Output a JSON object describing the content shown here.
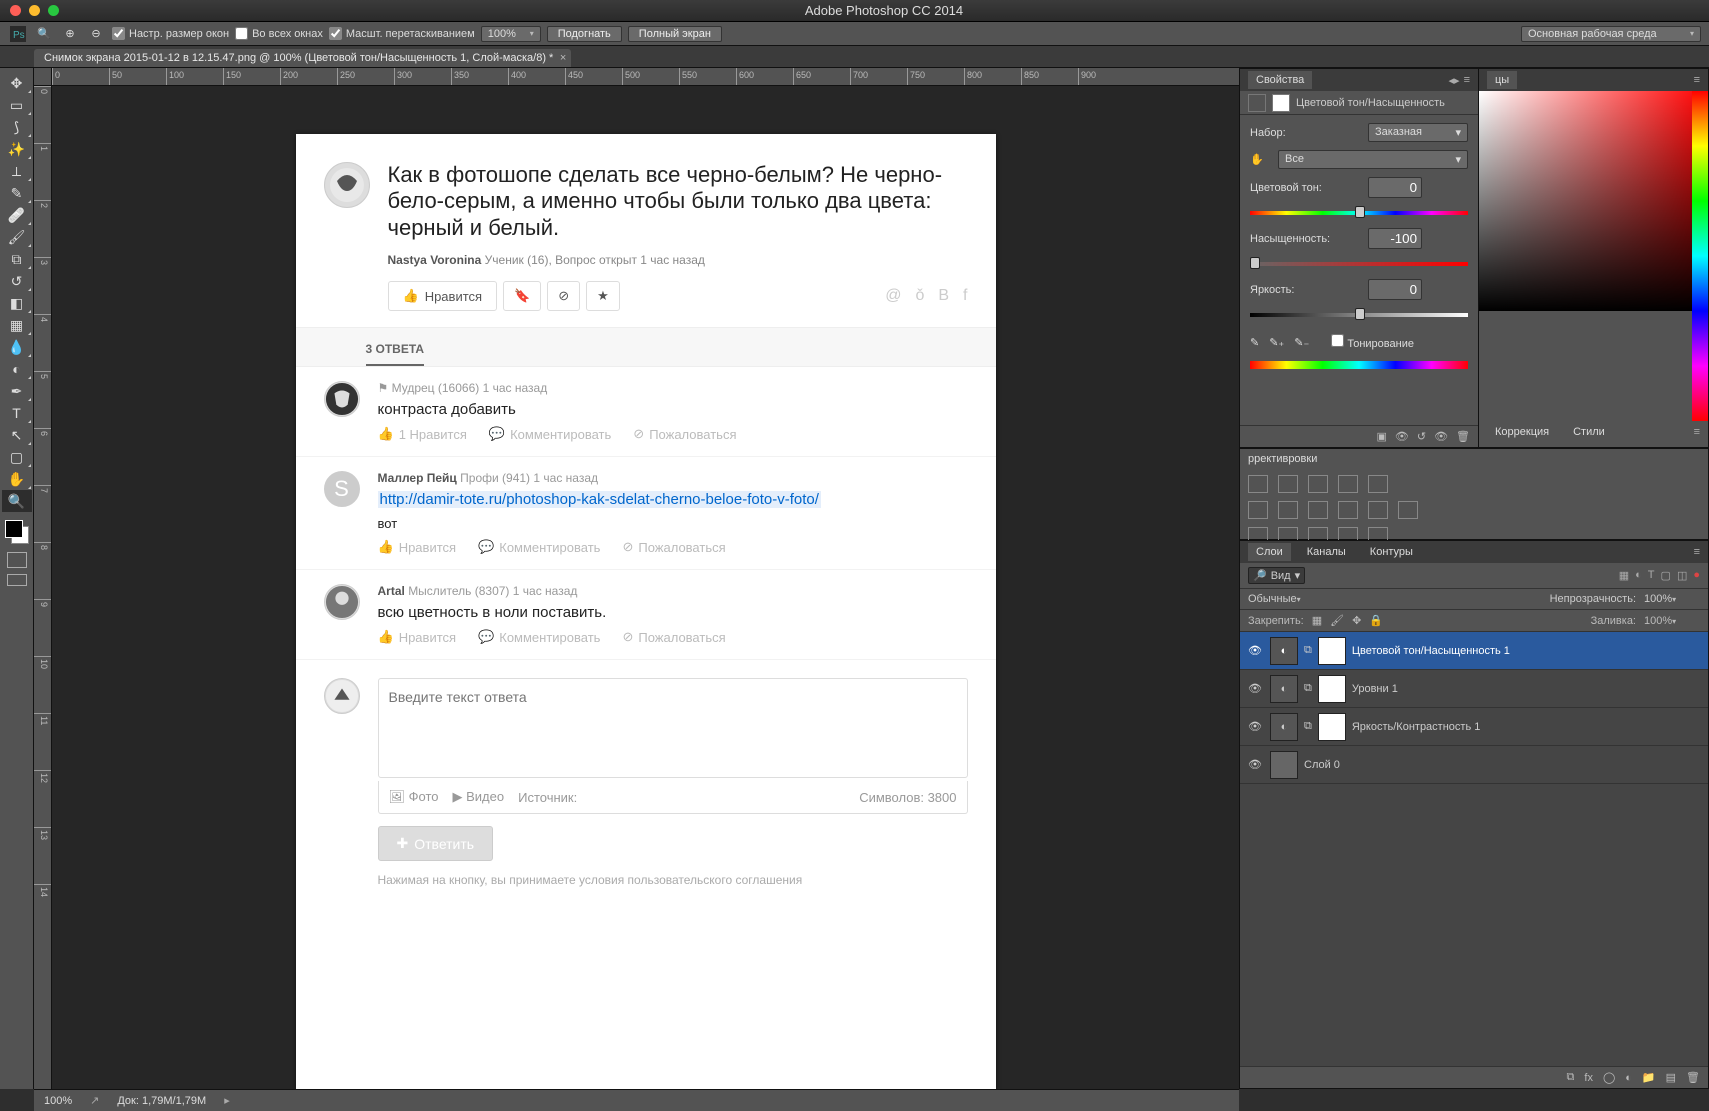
{
  "app_title": "Adobe Photoshop CC 2014",
  "workspace": "Основная рабочая среда",
  "options": {
    "resize_windows": "Настр. размер окон",
    "all_windows": "Во всех окнах",
    "scrubby": "Масшт. перетаскиванием",
    "zoom_pct": "100%",
    "fit": "Подогнать",
    "fullscreen": "Полный экран"
  },
  "doc_tab": "Снимок экрана 2015-01-12 в 12.15.47.png @ 100% (Цветовой тон/Насыщенность 1, Слой-маска/8) *",
  "ruler_marks_h": [
    "0",
    "50",
    "100",
    "150",
    "200",
    "250",
    "300",
    "350",
    "400",
    "450",
    "500",
    "550",
    "600",
    "650",
    "700",
    "750",
    "800",
    "850",
    "900"
  ],
  "ruler_marks_v": [
    "0",
    "1",
    "2",
    "3",
    "4",
    "5",
    "6",
    "7",
    "8",
    "9",
    "10",
    "11",
    "12",
    "13",
    "14"
  ],
  "question": {
    "title": "Как в фотошопе сделать все черно-белым? Не черно-бело-серым, а именно чтобы были только два цвета: черный и белый.",
    "author": "Nastya Voronina",
    "author_rank": "Ученик (16), Вопрос открыт 1 час назад",
    "like": "Нравится",
    "answers_header": "3 ОТВЕТА"
  },
  "answers": [
    {
      "author": "",
      "rank": "Мудрец (16066)",
      "time": "1 час назад",
      "text": "контраста добавить",
      "like": "1 Нравится",
      "comment": "Комментировать",
      "complain": "Пожаловаться"
    },
    {
      "author": "Маллер Пейц",
      "rank": "Профи (941)",
      "time": "1 час назад",
      "link": "http://damir-tote.ru/photoshop-kak-sdelat-cherno-beloe-foto-v-foto/",
      "text2": "вот",
      "like": "Нравится",
      "comment": "Комментировать",
      "complain": "Пожаловаться"
    },
    {
      "author": "Artal",
      "rank": "Мыслитель (8307)",
      "time": "1 час назад",
      "text": "всю цветность в ноли поставить.",
      "like": "Нравится",
      "comment": "Комментировать",
      "complain": "Пожаловаться"
    }
  ],
  "reply": {
    "placeholder": "Введите текст ответа",
    "photo": "Фото",
    "video": "Видео",
    "source": "Источник:",
    "chars": "Символов: 3800",
    "submit": "Ответить",
    "tos": "Нажимая на кнопку, вы принимаете условия пользовательского соглашения"
  },
  "props": {
    "panel_name": "Свойства",
    "title": "Цветовой тон/Насыщенность",
    "preset_lbl": "Набор:",
    "preset_val": "Заказная",
    "channel_val": "Все",
    "hue_lbl": "Цветовой тон:",
    "hue_val": "0",
    "sat_lbl": "Насыщенность:",
    "sat_val": "-100",
    "lig_lbl": "Яркость:",
    "lig_val": "0",
    "colorize": "Тонирование"
  },
  "swatches_tab": "цы",
  "corrections_tab": "Коррекция",
  "styles_tab": "Стили",
  "adjustments_lbl": "ррективровки",
  "layers": {
    "tab_layers": "Слои",
    "tab_channels": "Каналы",
    "tab_paths": "Контуры",
    "filter": "Вид",
    "blend_mode": "Обычные",
    "opacity_lbl": "Непрозрачность:",
    "opacity_val": "100%",
    "lock_lbl": "Закрепить:",
    "fill_lbl": "Заливка:",
    "fill_val": "100%",
    "rows": [
      {
        "name": "Цветовой тон/Насыщенность 1",
        "sel": true
      },
      {
        "name": "Уровни 1",
        "sel": false
      },
      {
        "name": "Яркость/Контрастность 1",
        "sel": false
      },
      {
        "name": "Слой 0",
        "sel": false
      }
    ]
  },
  "status": {
    "zoom": "100%",
    "doc": "Док: 1,79M/1,79M"
  }
}
